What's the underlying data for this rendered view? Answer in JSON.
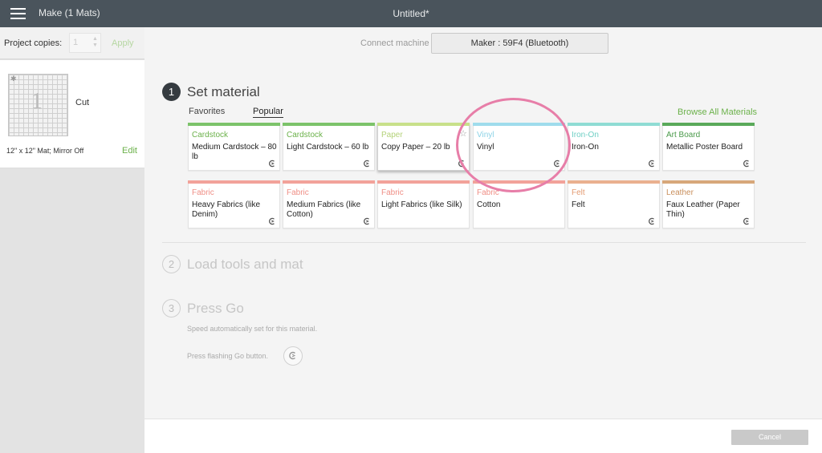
{
  "topbar": {
    "app_title": "Make (1 Mats)",
    "doc_title": "Untitled*"
  },
  "sidebar": {
    "copies_label": "Project copies:",
    "copies_value": "1",
    "apply_label": "Apply",
    "mat": {
      "thumb_number": "1",
      "mode": "Cut",
      "info": "12\" x 12\" Mat; Mirror Off",
      "edit_label": "Edit"
    }
  },
  "main": {
    "connect_label": "Connect machine",
    "machine_name": "Maker : 59F4 (Bluetooth)",
    "step1": {
      "number": "1",
      "title": "Set material",
      "tabs": [
        "Favorites",
        "Popular"
      ],
      "active_tab": "Popular",
      "browse_label": "Browse All Materials",
      "materials": [
        {
          "category": "Cardstock",
          "name": "Medium Cardstock – 80 lb",
          "color": "#7cc36a",
          "text_color": "#6bb14a"
        },
        {
          "category": "Cardstock",
          "name": "Light Cardstock – 60 lb",
          "color": "#7cc36a",
          "text_color": "#6bb14a"
        },
        {
          "category": "Paper",
          "name": "Copy Paper – 20 lb",
          "color": "#c8e08a",
          "text_color": "#b4d279"
        },
        {
          "category": "Vinyl",
          "name": "Vinyl",
          "color": "#9fdcec",
          "text_color": "#8bd2e6"
        },
        {
          "category": "Iron-On",
          "name": "Iron-On",
          "color": "#8fdcd4",
          "text_color": "#6fcfc4"
        },
        {
          "category": "Art Board",
          "name": "Metallic Poster Board",
          "color": "#5aa95a",
          "text_color": "#4a9a4a"
        },
        {
          "category": "Fabric",
          "name": "Heavy Fabrics (like Denim)",
          "color": "#f2a29a",
          "text_color": "#ef8f86"
        },
        {
          "category": "Fabric",
          "name": "Medium Fabrics (like Cotton)",
          "color": "#f2a29a",
          "text_color": "#ef8f86"
        },
        {
          "category": "Fabric",
          "name": "Light Fabrics (like Silk)",
          "color": "#f2a29a",
          "text_color": "#ef8f86"
        },
        {
          "category": "Fabric",
          "name": "Cotton",
          "color": "#f2a29a",
          "text_color": "#ef8f86"
        },
        {
          "category": "Felt",
          "name": "Felt",
          "color": "#eab08f",
          "text_color": "#e49c73"
        },
        {
          "category": "Leather",
          "name": "Faux Leather (Paper Thin)",
          "color": "#d7a77a",
          "text_color": "#c98f5c"
        }
      ]
    },
    "step2": {
      "number": "2",
      "title": "Load tools and mat"
    },
    "step3": {
      "number": "3",
      "title": "Press Go",
      "speed_note": "Speed automatically set for this material.",
      "go_note": "Press flashing Go button."
    }
  },
  "footer": {
    "cancel_label": "Cancel"
  },
  "icons": {
    "menu": "hamburger-icon",
    "cut": "cricut-c-icon",
    "favorite": "star-icon",
    "go": "go-button-icon"
  },
  "colors": {
    "topbar": "#4a545c",
    "accent_green": "#6bb14a",
    "highlight_pink": "#e77ea8"
  }
}
